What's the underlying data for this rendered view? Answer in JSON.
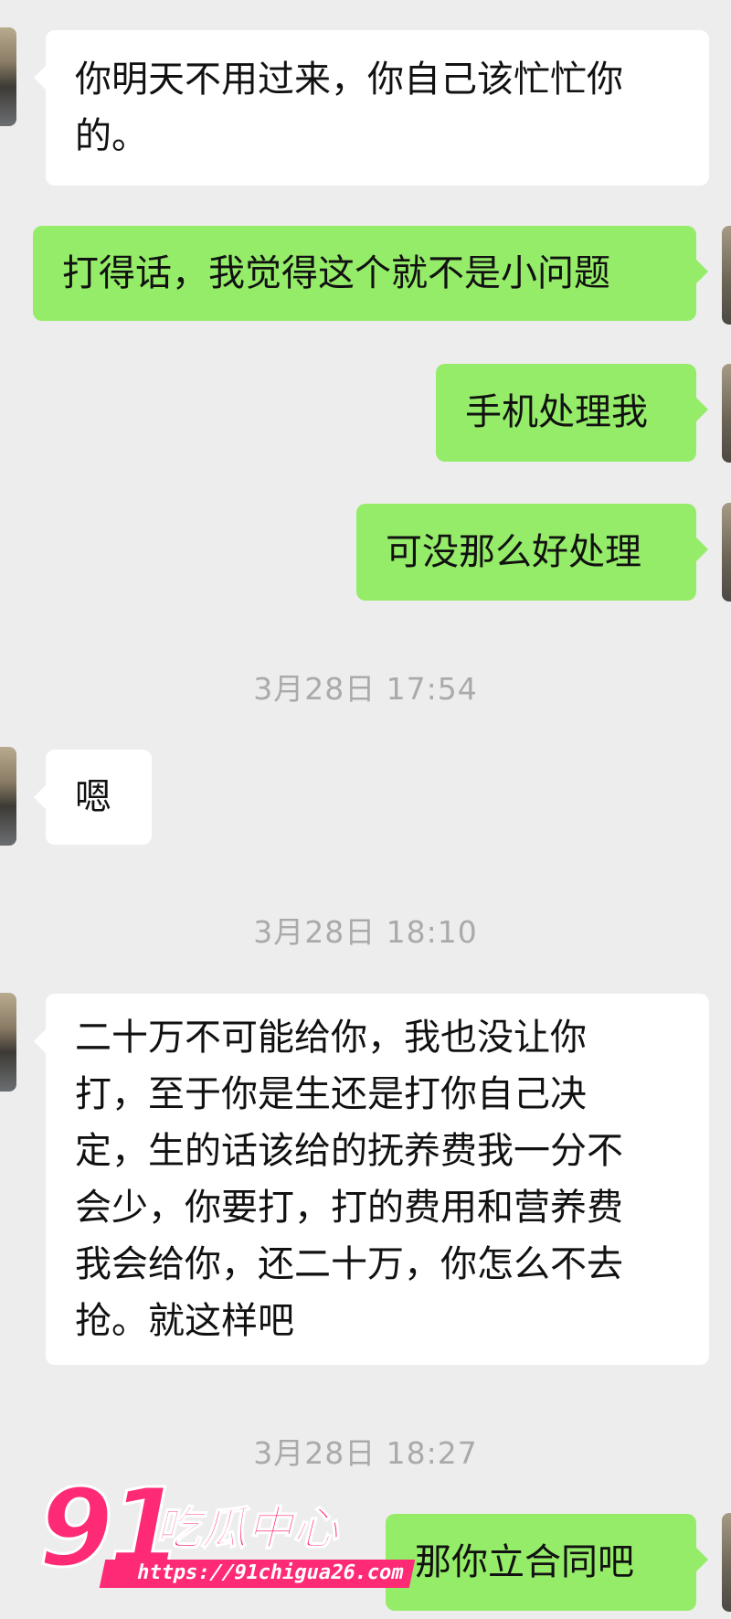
{
  "messages": [
    {
      "id": "m1",
      "side": "in",
      "text": "你明天不用过来，你自己该忙忙你的。",
      "lines": [
        "你明天不用过来，你自己该忙忙你",
        "的。"
      ]
    },
    {
      "id": "m2",
      "side": "out",
      "text": "打得话，我觉得这个就不是小问题"
    },
    {
      "id": "m3",
      "side": "out",
      "text": "手机处理我"
    },
    {
      "id": "m4",
      "side": "out",
      "text": "可没那么好处理"
    },
    {
      "id": "t1",
      "type": "timestamp",
      "text": "3月28日 17:54"
    },
    {
      "id": "m5",
      "side": "in",
      "text": "嗯"
    },
    {
      "id": "t2",
      "type": "timestamp",
      "text": "3月28日 18:10"
    },
    {
      "id": "m6",
      "side": "in",
      "text": "二十万不可能给你，我也没让你打，至于你是生还是打你自己决定，生的话该给的抚养费我一分不会少，你要打，打的费用和营养费我会给你，还二十万，你怎么不去抢。就这样吧",
      "lines": [
        "二十万不可能给你，我也没让你",
        "打，至于你是生还是打你自己决",
        "定，生的话该给的抚养费我一分不",
        "会少，你要打，打的费用和营养费",
        "我会给你，还二十万，你怎么不去",
        "抢。就这样吧"
      ]
    },
    {
      "id": "t3",
      "type": "timestamp",
      "text": "3月28日 18:27"
    },
    {
      "id": "m7",
      "side": "out",
      "text": "那你立合同吧"
    }
  ],
  "watermark": {
    "number": "91",
    "text": "吃瓜中心",
    "url": "https://91chigua26.com",
    "color": "#ff2a76"
  },
  "colors": {
    "background": "#ededed",
    "incoming_bubble": "#ffffff",
    "outgoing_bubble": "#95ec69",
    "timestamp": "#aaaaaa"
  }
}
